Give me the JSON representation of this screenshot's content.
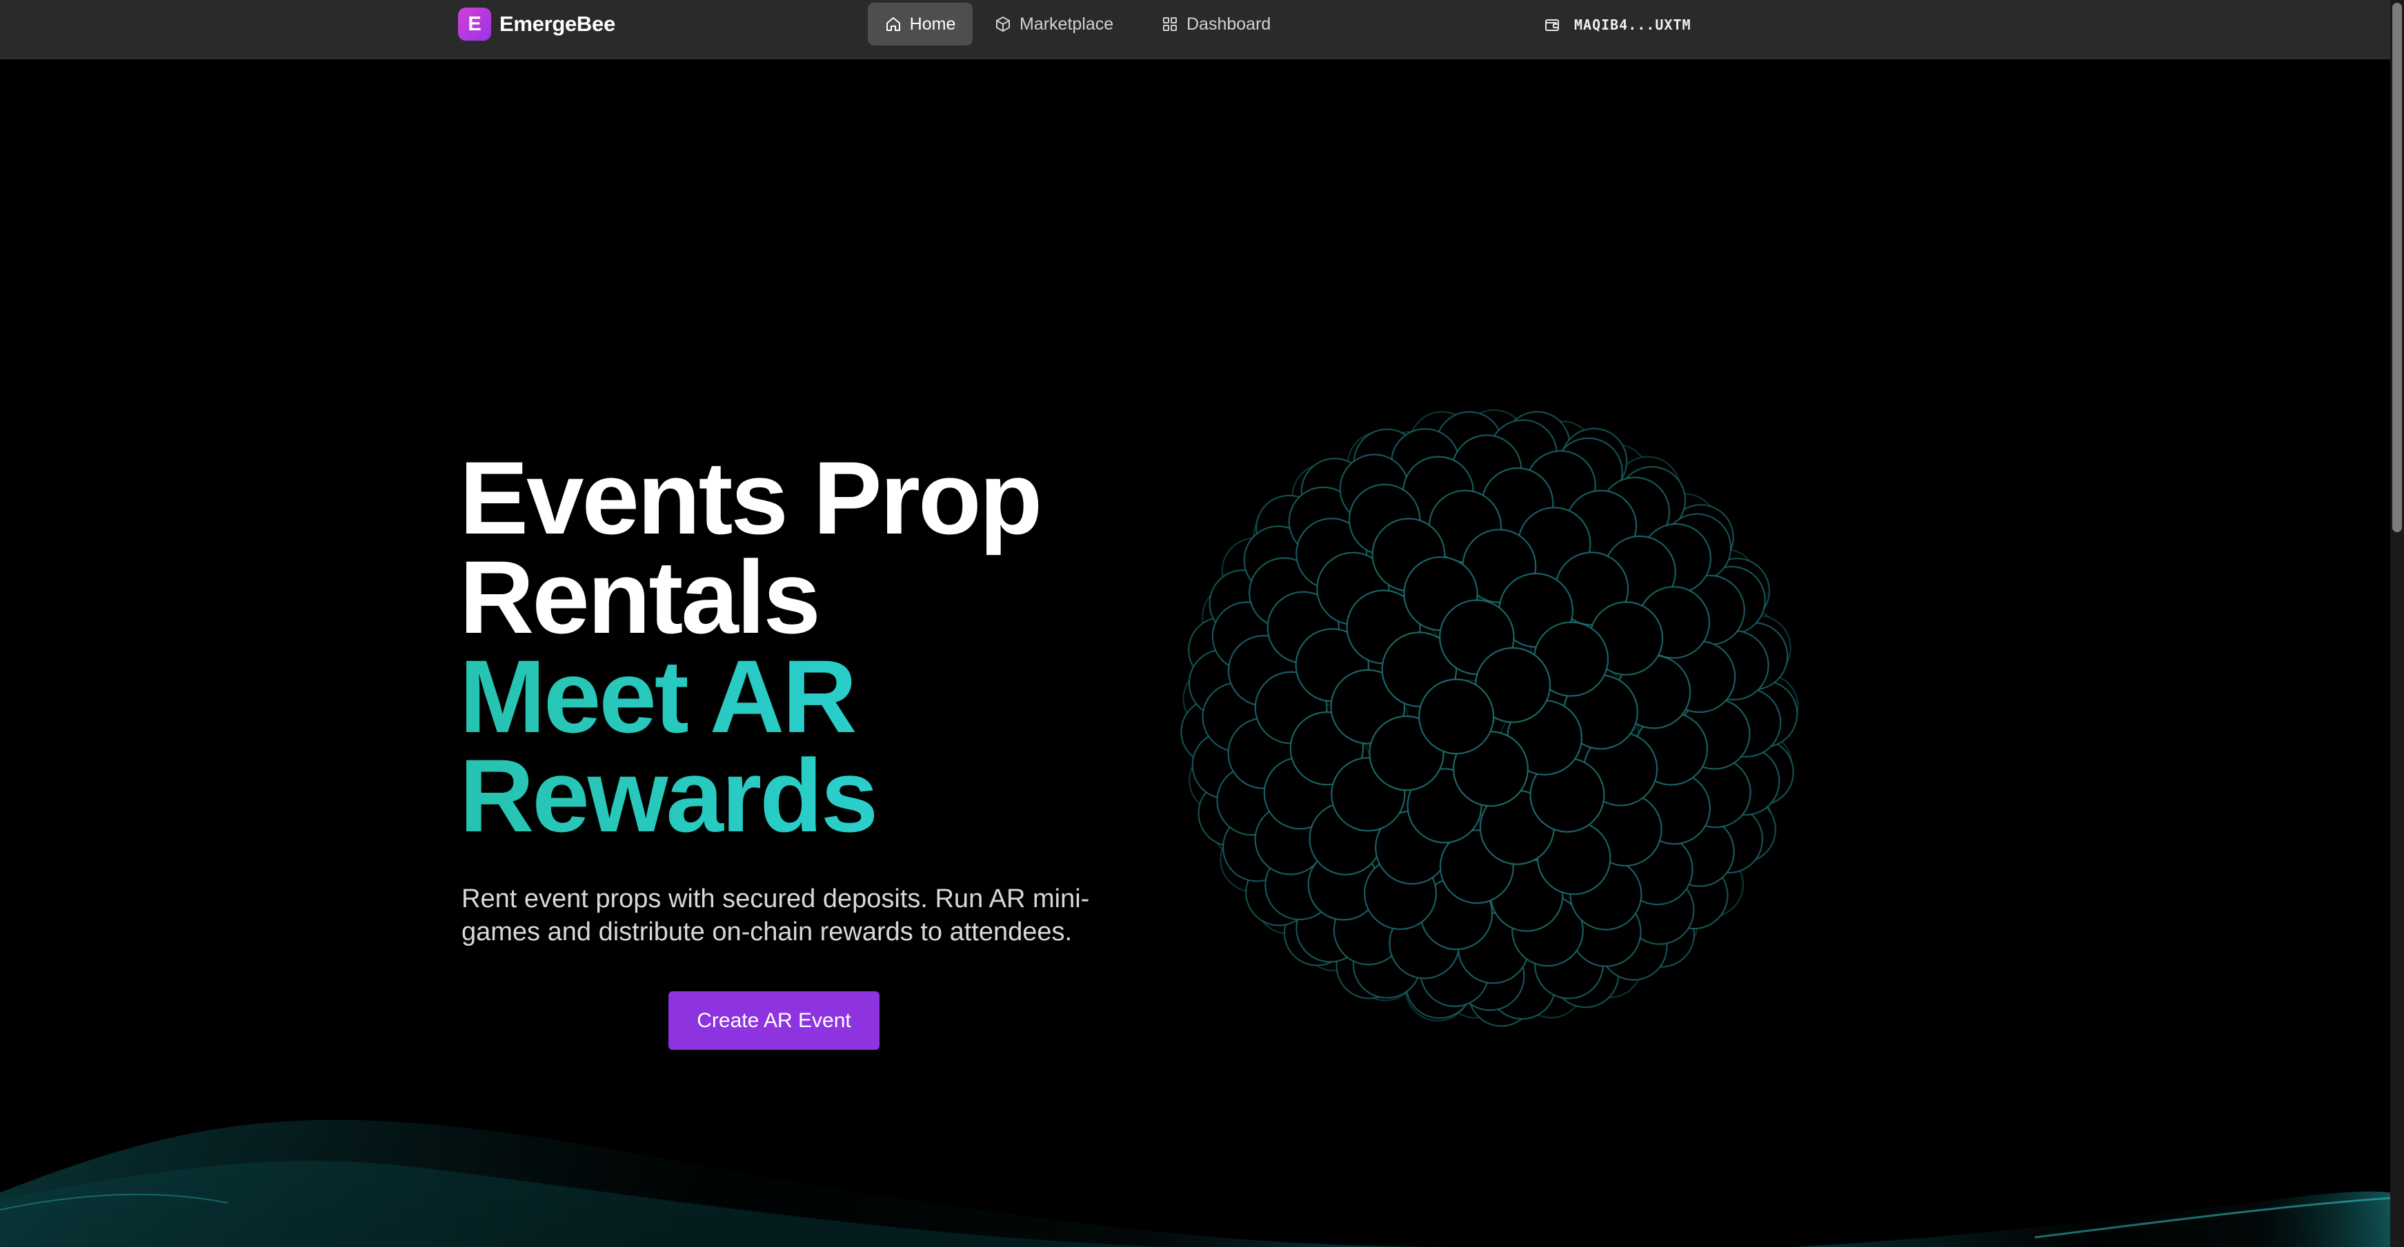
{
  "nav": {
    "brand_letter": "E",
    "brand_name": "EmergeBee",
    "items": [
      {
        "label": "Home",
        "icon": "home-icon",
        "active": true
      },
      {
        "label": "Marketplace",
        "icon": "cube-icon",
        "active": false
      },
      {
        "label": "Dashboard",
        "icon": "grid-icon",
        "active": false
      }
    ],
    "wallet": "MAQIB4...UXTM"
  },
  "hero": {
    "title_line1": "Events Prop",
    "title_line2": "Rentals",
    "accent_line1": "Meet AR",
    "accent_line2": "Rewards",
    "subtitle": "Rent event props with secured deposits. Run AR mini-games and distribute on-chain rewards to attendees.",
    "cta": "Create AR Event"
  },
  "colors": {
    "background": "#000000",
    "navbar": "#2a2a2a",
    "accent_teal": "#2bc8c0",
    "brand_purple": "#8e33e0",
    "logo_magenta": "#c23cdc"
  }
}
